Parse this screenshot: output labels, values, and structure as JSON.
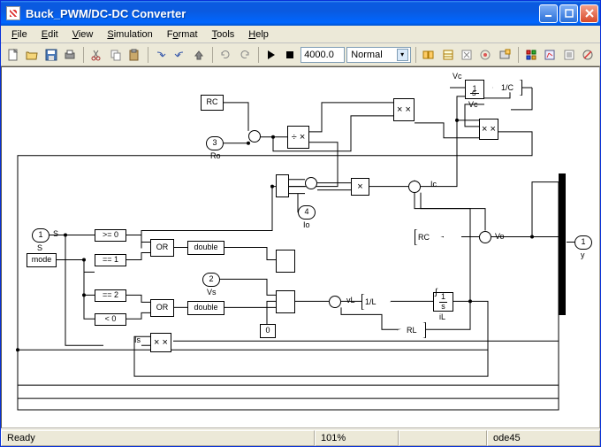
{
  "window": {
    "title": "Buck_PWM/DC-DC Converter"
  },
  "menu": {
    "file": "File",
    "file_u": "F",
    "edit": "Edit",
    "edit_u": "E",
    "view": "View",
    "view_u": "V",
    "simulation": "Simulation",
    "simulation_u": "S",
    "format": "Format",
    "format_u": "o",
    "tools": "Tools",
    "tools_u": "T",
    "help": "Help",
    "help_u": "H"
  },
  "toolbar": {
    "stop_time": "4000.0",
    "mode": "Normal"
  },
  "status": {
    "ready": "Ready",
    "zoom": "101%",
    "solver": "ode45"
  },
  "blocks": {
    "rc_const": "RC",
    "ro_port_num": "3",
    "ro_label": "Ro",
    "s_port_num": "1",
    "s_label": "S",
    "mode_in": "mode",
    "vs_port_num": "2",
    "vs_label": "Vs",
    "io_port_num": "4",
    "io_label": "Io",
    "out_port_num": "1",
    "out_label": "y",
    "cmp_ge0": ">= 0",
    "cmp_eq1": "== 1",
    "cmp_eq2": "== 2",
    "cmp_lt0": "< 0",
    "or1": "OR",
    "or2": "OR",
    "double1": "double",
    "double2": "double",
    "zero_const": "0",
    "is_label": "Is",
    "vl_label": "vL",
    "gain_1L": "1/L",
    "gain_RL": "RL",
    "gain_RC": "RC",
    "vo_label": "Vo",
    "vc_label": "Vc",
    "vc_top": "Vc",
    "ic_label": "Ic",
    "gain_1C": "1/C",
    "integ_s": "1",
    "integ_s_denom": "s",
    "integ_il": "1",
    "integ_il_denom": "s",
    "il_label": "iL",
    "divide": "÷\n×",
    "mult": "×\n×",
    "mult2": "×\n×",
    "mult_is": "×\n×"
  }
}
